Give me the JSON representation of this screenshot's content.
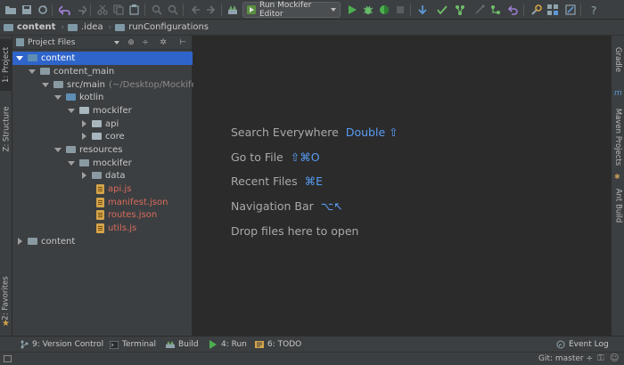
{
  "toolbar": {
    "run_config": "Run Mockifer Editor",
    "icons": [
      "open-folder",
      "save",
      "sync",
      "undo",
      "redo",
      "cut",
      "copy",
      "paste",
      "find",
      "replace",
      "back",
      "forward",
      "build",
      "run",
      "debug",
      "coverage",
      "stop",
      "vcs-update",
      "vcs-commit",
      "vcs-compare",
      "vcs-history",
      "vcs-revert",
      "settings",
      "project-structure",
      "sdk-manager",
      "help"
    ],
    "accent_run": "#4caf50",
    "accent_debug": "#66bb6a"
  },
  "breadcrumb": {
    "items": [
      "content",
      ".idea",
      "runConfigurations"
    ]
  },
  "left_stripe": {
    "project_tab": "1: Project",
    "structure_tab": "Z: Structure",
    "favorites_tab": "2: Favorites"
  },
  "right_stripe": {
    "gradle_tab": "Gradle",
    "maven_tab": "Maven Projects",
    "ant_tab": "Ant Build"
  },
  "project_panel": {
    "view_mode": "Project Files",
    "tree": {
      "r0": "content",
      "r1": "content_main",
      "r2": "src/main",
      "r2_hint": "(~/Desktop/Mockifer",
      "r3": "kotlin",
      "r4": "mockifer",
      "r5": "api",
      "r6": "core",
      "r7": "resources",
      "r8": "mockifer",
      "r9": "data",
      "r10": "api.js",
      "r11": "manifest.json",
      "r12": "routes.json",
      "r13": "utils.js",
      "r14": "content"
    },
    "selection_color": "#2f65ca",
    "modified_file_color": "#d96b5c"
  },
  "editor": {
    "hints": {
      "search_label": "Search Everywhere",
      "search_key": "Double ⇧",
      "goto_label": "Go to File",
      "goto_key": "⇧⌘O",
      "recent_label": "Recent Files",
      "recent_key": "⌘E",
      "nav_label": "Navigation Bar",
      "nav_key": "⌥↖",
      "drop_label": "Drop files here to open"
    },
    "shortcut_color": "#589df6"
  },
  "bottom_bar": {
    "version_control": "9: Version Control",
    "terminal": "Terminal",
    "build": "Build",
    "run": "4: Run",
    "todo": "6: TODO",
    "event_log": "Event Log"
  },
  "status_bar": {
    "git": "Git: master ÷"
  }
}
